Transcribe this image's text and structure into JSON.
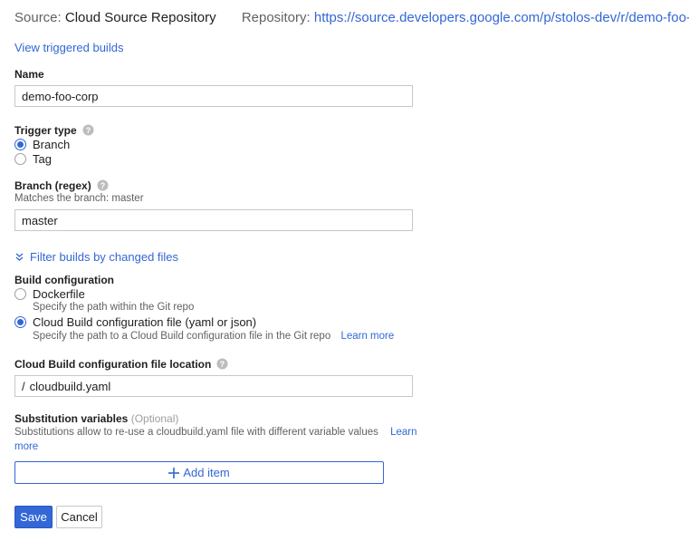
{
  "header": {
    "source_label": "Source: ",
    "source_value": "Cloud Source Repository",
    "repo_label": "Repository: ",
    "repo_url": "https://source.developers.google.com/p/stolos-dev/r/demo-foo-corp"
  },
  "view_builds_link": "View triggered builds",
  "name": {
    "label": "Name",
    "value": "demo-foo-corp"
  },
  "trigger_type": {
    "label": "Trigger type",
    "options": [
      {
        "label": "Branch",
        "checked": true
      },
      {
        "label": "Tag",
        "checked": false
      }
    ]
  },
  "branch": {
    "label": "Branch (regex)",
    "hint": "Matches the branch: master",
    "value": "master"
  },
  "filter_link": "Filter builds by changed files",
  "build_config": {
    "label": "Build configuration",
    "options": [
      {
        "label": "Dockerfile",
        "hint": "Specify the path within the Git repo",
        "checked": false
      },
      {
        "label": "Cloud Build configuration file (yaml or json)",
        "hint": "Specify the path to a Cloud Build configuration file in the Git repo",
        "checked": true
      }
    ],
    "learn_more": "Learn more"
  },
  "config_location": {
    "label": "Cloud Build configuration file location",
    "prefix": "/",
    "value": "cloudbuild.yaml"
  },
  "substitution": {
    "label": "Substitution variables",
    "optional": "(Optional)",
    "description": "Substitutions allow to re-use a cloudbuild.yaml file with different variable values",
    "learn": "Learn",
    "more": "more",
    "add_item": "Add item"
  },
  "actions": {
    "save": "Save",
    "cancel": "Cancel"
  },
  "colors": {
    "accent": "#3367d6",
    "text": "#212121",
    "muted": "#616161",
    "border": "#c8c8c8"
  },
  "icons": {
    "help": "help-circle-icon",
    "chevron": "double-chevron-down-icon",
    "plus": "plus-icon"
  }
}
